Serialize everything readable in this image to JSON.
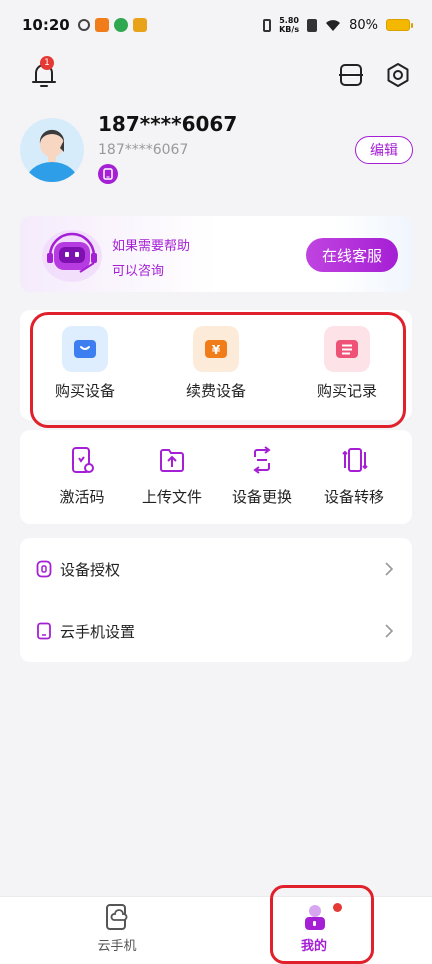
{
  "status": {
    "time": "10:20",
    "netspeed_value": "5.80",
    "netspeed_unit": "KB/s",
    "battery": "80%"
  },
  "notifications": {
    "badge": "1"
  },
  "profile": {
    "username": "187****6067",
    "phone": "187****6067",
    "edit_label": "编辑"
  },
  "help": {
    "line1": "如果需要帮助",
    "line2": "可以咨询",
    "button": "在线客服"
  },
  "purchase": [
    {
      "label": "购买设备",
      "icon": "buy-device-icon"
    },
    {
      "label": "续费设备",
      "icon": "renew-device-icon"
    },
    {
      "label": "购买记录",
      "icon": "purchase-record-icon"
    }
  ],
  "tools": [
    {
      "label": "激活码",
      "icon": "activation-code-icon"
    },
    {
      "label": "上传文件",
      "icon": "upload-file-icon"
    },
    {
      "label": "设备更换",
      "icon": "device-replace-icon"
    },
    {
      "label": "设备转移",
      "icon": "device-transfer-icon"
    }
  ],
  "list": [
    {
      "label": "设备授权",
      "icon": "authorization-icon"
    },
    {
      "label": "云手机设置",
      "icon": "phone-settings-icon"
    }
  ],
  "tabs": [
    {
      "label": "云手机",
      "active": false
    },
    {
      "label": "我的",
      "active": true
    }
  ],
  "colors": {
    "accent": "#a51fd4",
    "highlight": "#e0202a",
    "inactive_tab": "#555555"
  }
}
